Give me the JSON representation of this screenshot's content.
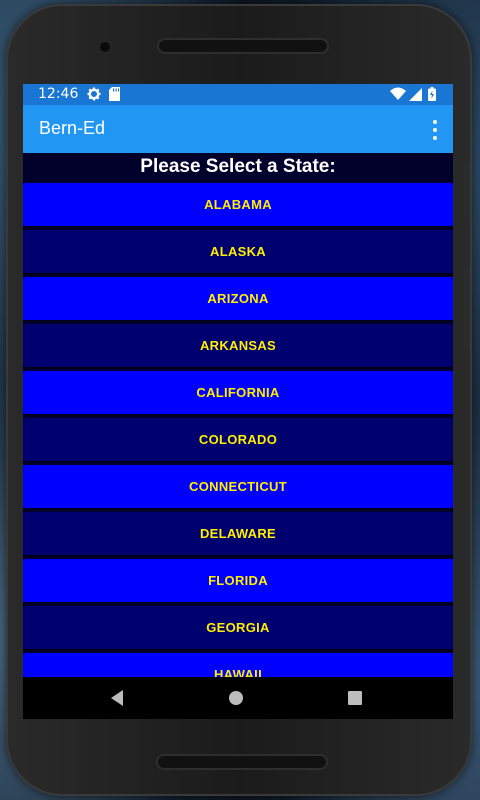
{
  "status_bar": {
    "time": "12:46",
    "icons": [
      "settings-icon",
      "sd-card-icon",
      "wifi-icon",
      "signal-icon",
      "battery-icon"
    ]
  },
  "app_bar": {
    "title": "Bern-Ed",
    "menu_icon": "overflow-menu-icon"
  },
  "header": {
    "text": "Please Select a State:"
  },
  "states": [
    "ALABAMA",
    "ALASKA",
    "ARIZONA",
    "ARKANSAS",
    "CALIFORNIA",
    "COLORADO",
    "CONNECTICUT",
    "DELAWARE",
    "FLORIDA",
    "GEORGIA",
    "HAWAII"
  ],
  "colors": {
    "status_bar": "#1976d2",
    "app_bar": "#2196f3",
    "button_bright": "#0000ff",
    "button_dark": "#00006e",
    "button_text": "#ffee00"
  },
  "nav_bar": {
    "icons": [
      "back-icon",
      "home-icon",
      "recents-icon"
    ]
  }
}
